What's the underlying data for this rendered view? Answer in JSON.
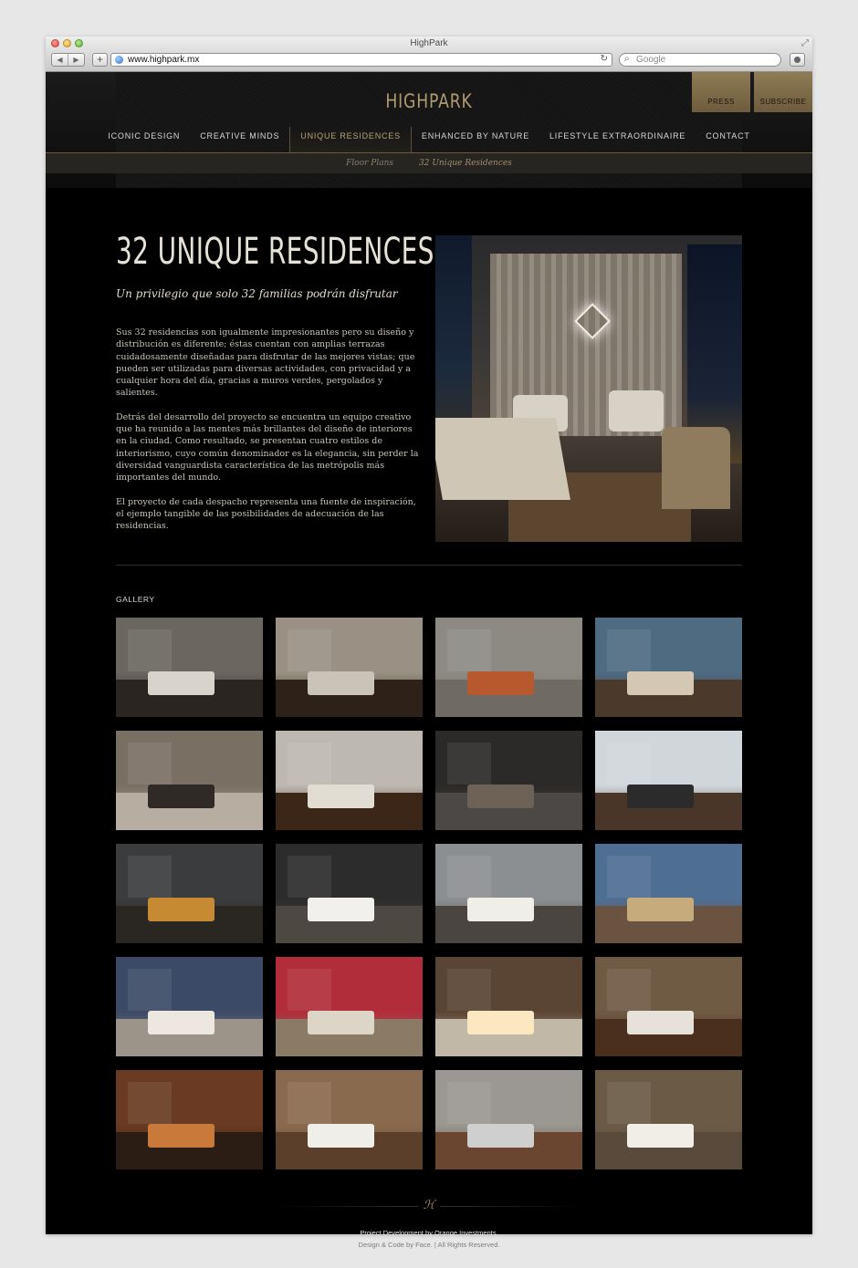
{
  "browser": {
    "window_title": "HighPark",
    "url": "www.highpark.mx",
    "search_placeholder": "Google"
  },
  "header": {
    "logo": "HIGHPARK",
    "press_label": "PRESS",
    "subscribe_label": "SUBSCRIBE",
    "accent_color": "#8f7b55"
  },
  "nav": {
    "items": [
      {
        "label": "ICONIC DESIGN"
      },
      {
        "label": "CREATIVE MINDS"
      },
      {
        "label": "UNIQUE RESIDENCES",
        "active": true
      },
      {
        "label": "ENHANCED BY NATURE"
      },
      {
        "label": "LIFESTYLE EXTRAORDINAIRE"
      },
      {
        "label": "CONTACT"
      }
    ]
  },
  "subnav": {
    "items": [
      {
        "label": "Floor Plans"
      },
      {
        "label": "32 Unique Residences",
        "active": true
      }
    ]
  },
  "main": {
    "title": "32 UNIQUE RESIDENCES",
    "subtitle": "Un privilegio que solo 32 familias podrán disfrutar",
    "paragraphs": [
      "Sus 32 residencias son igualmente impresionantes pero su diseño y distribución es diferente; éstas cuentan con amplias terrazas cuidadosamente diseñadas para disfrutar de las mejores vistas; que pueden ser utilizadas para diversas actividades, con privacidad y a cualquier hora del día, gracias a muros verdes, pergolados y salientes.",
      "Detrás del desarrollo del proyecto se encuentra un equipo creativo que ha reunido a las mentes más brillantes del diseño de interiores en la ciudad. Como resultado, se presentan cuatro estilos de interiorismo, cuyo común denominador es la elegancia, sin perder la diversidad vanguardista característica de las metrópolis más importantes del mundo.",
      "El proyecto de cada despacho representa una fuente de inspiración, el ejemplo tangible de las posibilidades de adecuación de las residencias."
    ]
  },
  "gallery": {
    "label": "GALLERY",
    "thumbs": [
      {
        "wall": "#6b6660",
        "floor": "#2b2522",
        "item": "#d8d4cc"
      },
      {
        "wall": "#9a9184",
        "floor": "#2e2218",
        "item": "#c9c3b8"
      },
      {
        "wall": "#8d8a84",
        "floor": "#6f6a63",
        "item": "#b8582e"
      },
      {
        "wall": "#4f6b82",
        "floor": "#4b3a2c",
        "item": "#d4c8b4"
      },
      {
        "wall": "#7a6f63",
        "floor": "#b7ada0",
        "item": "#2f2a25"
      },
      {
        "wall": "#bdb8b0",
        "floor": "#3b2618",
        "item": "#e2ddd3"
      },
      {
        "wall": "#2b2a28",
        "floor": "#4b4845",
        "item": "#6e6256"
      },
      {
        "wall": "#d0d6da",
        "floor": "#4a3628",
        "item": "#2b2b2b"
      },
      {
        "wall": "#3a3c3e",
        "floor": "#2a2622",
        "item": "#c68b32"
      },
      {
        "wall": "#2c2c2c",
        "floor": "#4e4843",
        "item": "#f2f0ec"
      },
      {
        "wall": "#8c8f92",
        "floor": "#4a4540",
        "item": "#f0eee9"
      },
      {
        "wall": "#4f6e93",
        "floor": "#6a5340",
        "item": "#c6ab7c"
      },
      {
        "wall": "#3b4a66",
        "floor": "#9d9489",
        "item": "#ece8e0"
      },
      {
        "wall": "#b12d3a",
        "floor": "#8b7a66",
        "item": "#ddd5c6"
      },
      {
        "wall": "#5a4434",
        "floor": "#c2b8a8",
        "item": "#fbe7c0"
      },
      {
        "wall": "#6f5a44",
        "floor": "#4a2f1e",
        "item": "#e7e2d9"
      },
      {
        "wall": "#6a3b22",
        "floor": "#2b1c14",
        "item": "#c97a3a"
      },
      {
        "wall": "#8a6a4e",
        "floor": "#5b3f2b",
        "item": "#f0eee8"
      },
      {
        "wall": "#9b9793",
        "floor": "#6a4630",
        "item": "#cfcfcf"
      },
      {
        "wall": "#6b5a46",
        "floor": "#5a4a3c",
        "item": "#f1eee7"
      }
    ]
  },
  "footer": {
    "monogram": "ℋ",
    "credit": "Project Development by Orange Investments.",
    "design": "Design & Code by Face. | All Rights Reserved."
  }
}
